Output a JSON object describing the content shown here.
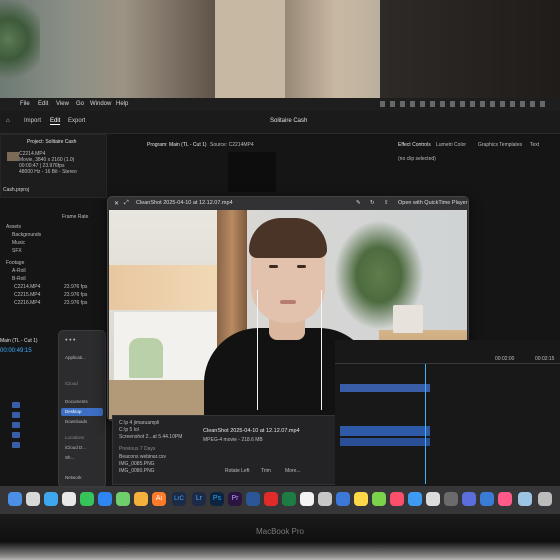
{
  "menubar": {
    "items": [
      "File",
      "Edit",
      "View",
      "Go",
      "Window",
      "Help"
    ]
  },
  "premiere": {
    "tabs": [
      "Import",
      "Edit",
      "Export"
    ],
    "project_title": "Solitaire Cash",
    "panel_tabs": [
      "Project: Solitaire Cash",
      "Program: Main (TL - Cut 1)",
      "Source: C2214MP4"
    ],
    "right_tabs": [
      "Effect Controls",
      "Lumetri Color",
      "Graphics Templates",
      "Text"
    ],
    "no_clip": "(no clip selected)",
    "clip_name": "C2214.MP4",
    "clip_meta": [
      "Movie, 3840 x 2160 (1.0)",
      "00:00:47 | 23.976fps",
      "48000 Hz - 16 Bit - Stereo"
    ],
    "project_file": "Cash.prproj",
    "bins": [
      "Assets",
      "Backgrounds",
      "Music",
      "SFX",
      "Footage",
      "A-Roll",
      "B-Roll"
    ],
    "clips": [
      {
        "name": "C2214.MP4",
        "fps": "23.976 fps"
      },
      {
        "name": "C2215.MP4",
        "fps": "23.976 fps"
      },
      {
        "name": "C2216.MP4",
        "fps": "23.976 fps"
      }
    ],
    "frame_rate_label": "Frame Rate",
    "seq_name": "Main (TL - Cut 1)",
    "timecode": "00:00:49:15",
    "ruler_marks": [
      "00:02:00",
      "00:02:15"
    ]
  },
  "finder": {
    "items": [
      "Applicati...",
      "Desktop",
      "Documents",
      "Downloads"
    ],
    "section_cloud": "iCloud",
    "section_locations": "Locations",
    "locations": [
      "iCloud D...",
      "Sh...",
      "Network"
    ]
  },
  "quicklook": {
    "title": "CleanShot 2025-04-10 at 12.12.07.mp4",
    "open_with": "Open with QuickTime Player"
  },
  "preview": {
    "files": [
      "C:\\p 4 jimaruampli",
      "C:\\p 5 lol",
      "Screenshot 2...at 5.44.10PM"
    ],
    "section_prev7": "Previous 7 Days",
    "prev_files": [
      "Beacons webinar.csv",
      "IMG_0085.PNG",
      "IMG_0080.PNG"
    ],
    "name": "CleanShot 2025-04-10 at 12.12.07.mp4",
    "meta": "MPEG-4 movie - 218.6 MB",
    "actions": [
      "Rotate Left",
      "Trim",
      "More..."
    ]
  },
  "dock": {
    "apps": [
      "finder-icon",
      "launchpad-icon",
      "safari-icon",
      "chrome-icon",
      "messages-icon",
      "mail-icon",
      "maps-icon",
      "photos-icon",
      "facetime-icon",
      "calendar-icon",
      "contacts-icon",
      "reminders-icon",
      "notes-icon",
      "music-icon",
      "podcasts-icon",
      "tv-icon",
      "appstore-icon",
      "settings-icon",
      "illustrator-icon",
      "lrc-icon",
      "lightroom-icon",
      "photoshop-icon",
      "premiere-icon",
      "word-icon",
      "acrobat-icon",
      "excel-icon",
      "powerpoint-icon",
      "numbers-icon",
      "notion-icon",
      "keynote-icon",
      "zoom-icon",
      "slack-icon",
      "spotify-icon",
      "discord-icon",
      "whatsapp-icon",
      "vscode-icon",
      "terminal-icon",
      "figma-icon",
      "cleanshot-icon",
      "trash-icon"
    ],
    "labels": {
      "ai": "Ai",
      "lrc": "LrC",
      "lr": "Lr",
      "ps": "Ps",
      "pr": "Pr"
    }
  },
  "laptop": {
    "brand": "MacBook Pro"
  },
  "colors": {
    "accent": "#3c6fc4",
    "timeline_clip": "#3a5da8",
    "screen_bg": "#151515"
  }
}
